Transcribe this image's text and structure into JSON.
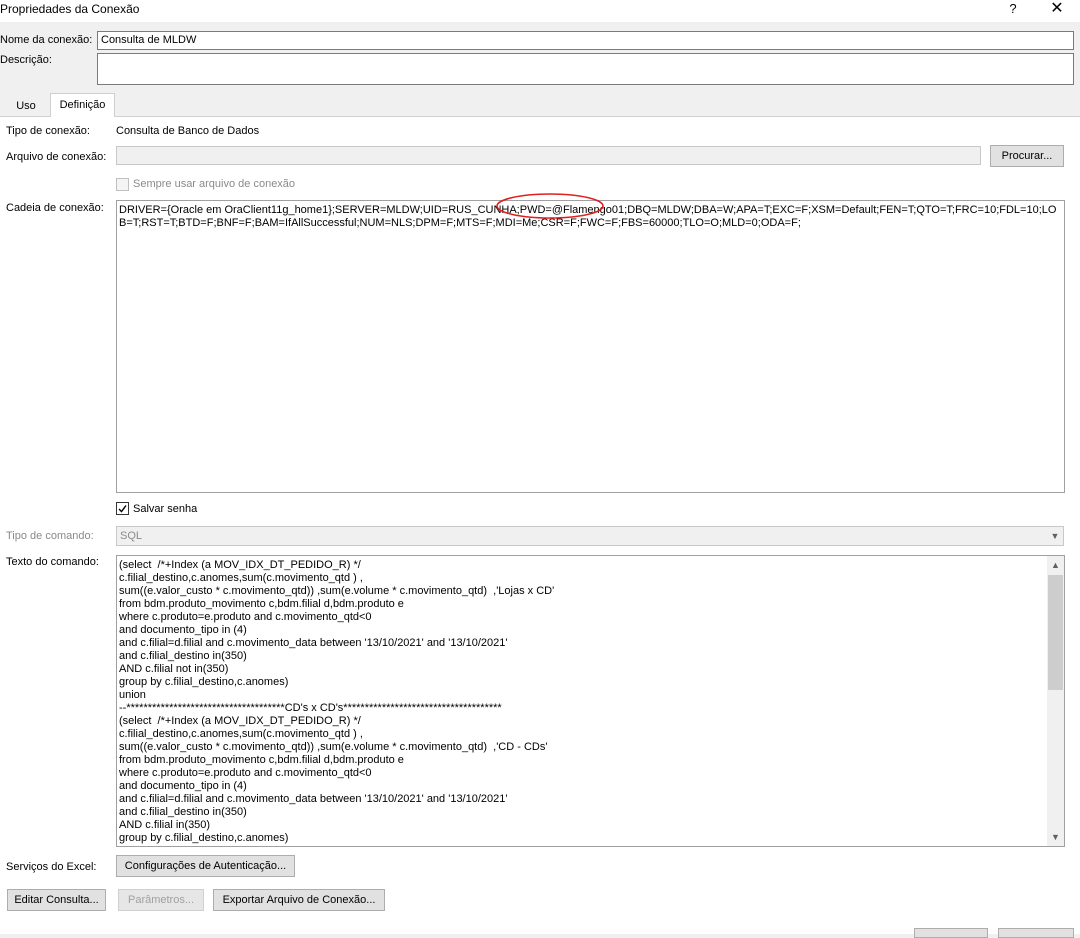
{
  "window": {
    "title": "Propriedades da Conexão",
    "help": "?",
    "close": "✕"
  },
  "connection": {
    "name_label": "Nome da conexão:",
    "name_value": "Consulta de MLDW",
    "desc_label": "Descrição:",
    "desc_value": ""
  },
  "tabs": [
    {
      "label": "Uso"
    },
    {
      "label": "Definição"
    }
  ],
  "definition": {
    "type_label": "Tipo de conexão:",
    "type_value": "Consulta de Banco de Dados",
    "file_label": "Arquivo de conexão:",
    "file_value": "",
    "browse_button": "Procurar...",
    "always_use_file_label": "Sempre usar arquivo de conexão",
    "conn_string_label": "Cadeia de conexão:",
    "conn_string_value": "DRIVER={Oracle em OraClient11g_home1};SERVER=MLDW;UID=RUS_CUNHA;PWD=@Flamengo01;DBQ=MLDW;DBA=W;APA=T;EXC=F;XSM=Default;FEN=T;QTO=T;FRC=10;FDL=10;LOB=T;RST=T;BTD=F;BNF=F;BAM=IfAllSuccessful;NUM=NLS;DPM=F;MTS=F;MDI=Me;CSR=F;FWC=F;FBS=60000;TLO=O;MLD=0;ODA=F;",
    "save_password_label": "Salvar senha",
    "command_type_label": "Tipo de comando:",
    "command_type_value": "SQL",
    "command_text_label": "Texto do comando:",
    "command_lines": [
      "(select  /*+Index (a MOV_IDX_DT_PEDIDO_R) */",
      "c.filial_destino,c.anomes,sum(c.movimento_qtd ) ,",
      "sum((e.valor_custo * c.movimento_qtd)) ,sum(e.volume * c.movimento_qtd)  ,'Lojas x CD'",
      "from bdm.produto_movimento c,bdm.filial d,bdm.produto e",
      "where c.produto=e.produto and c.movimento_qtd<0",
      "and documento_tipo in (4)",
      "and c.filial=d.filial and c.movimento_data between '13/10/2021' and '13/10/2021'",
      "and c.filial_destino in(350)",
      "AND c.filial not in(350)",
      "group by c.filial_destino,c.anomes)",
      "union",
      "--*************************************CD's x CD's*************************************",
      "(select  /*+Index (a MOV_IDX_DT_PEDIDO_R) */",
      "c.filial_destino,c.anomes,sum(c.movimento_qtd ) ,",
      "sum((e.valor_custo * c.movimento_qtd)) ,sum(e.volume * c.movimento_qtd)  ,'CD - CDs'",
      "from bdm.produto_movimento c,bdm.filial d,bdm.produto e",
      "where c.produto=e.produto and c.movimento_qtd<0",
      "and documento_tipo in (4)",
      "and c.filial=d.filial and c.movimento_data between '13/10/2021' and '13/10/2021'",
      "and c.filial_destino in(350)",
      "AND c.filial in(350)",
      "group by c.filial_destino,c.anomes)"
    ],
    "excel_services_label": "Serviços do Excel:",
    "auth_button": "Configurações de Autenticação..."
  },
  "footer": {
    "edit_query": "Editar Consulta...",
    "parameters": "Parâmetros...",
    "export": "Exportar Arquivo de Conexão..."
  }
}
